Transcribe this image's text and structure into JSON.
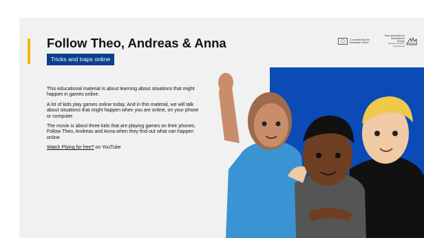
{
  "slide": {
    "title": "Follow Theo, Andreas & Anna",
    "subtitle": "Tricks and traps online",
    "paragraphs": [
      "This educational material is about learning about situations that might happen in games online.",
      "A lot of kids play games online today. And in this material, we will talk about situations that might happen when you are online, on your phone or computer.",
      "The movie is about three kids that are playing games on their phones. Follow Theo, Andreas and Anna when they find out what can happen online."
    ],
    "link_text": "Watch Plying for free?",
    "link_suffix": " on YouTube"
  },
  "logos": {
    "eu_text": "Co-funded by the European Union",
    "hjelp_text": "Help and advice for consumers in Europe",
    "hjelp_sub": "European Consumer Centre Norway"
  },
  "colors": {
    "accent": "#f7b500",
    "badge_bg": "#0b3f8f",
    "illustration_bg": "#0a4bb5"
  },
  "icons": {
    "eu_flag": "eu-flag-icon",
    "hjelp_logo": "hand-logo-icon"
  }
}
